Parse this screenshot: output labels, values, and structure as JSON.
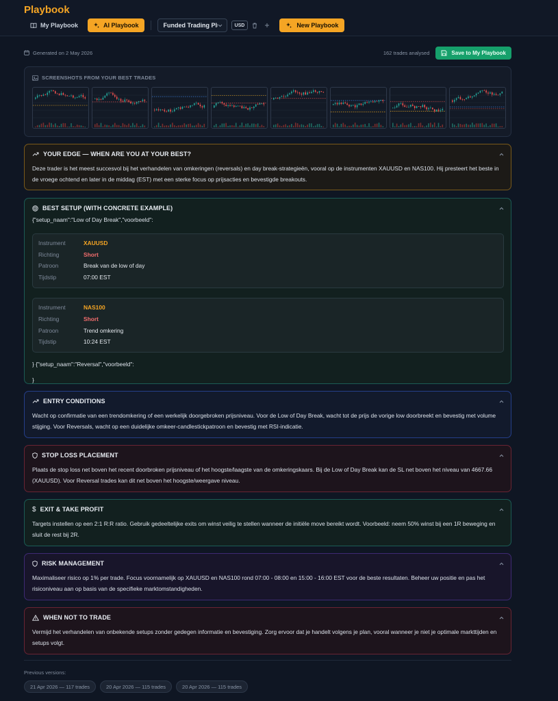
{
  "app": {
    "title": "Playbook"
  },
  "tabs": [
    {
      "label": "My Playbook",
      "icon": "book-icon"
    },
    {
      "label": "AI Playbook",
      "icon": "sparkle-icon"
    }
  ],
  "account": {
    "selected": "Funded Trading Plus",
    "currency": "USD"
  },
  "new_playbook_label": "New Playbook",
  "header": {
    "generated": "Generated on 2 May 2026",
    "trades_analysed": "162 trades analysed",
    "save_label": "Save to My Playbook"
  },
  "screenshots": {
    "title": "SCREENSHOTS FROM YOUR BEST TRADES",
    "count": 8
  },
  "sections": {
    "edge": {
      "title": "YOUR EDGE — WHEN ARE YOU AT YOUR BEST?",
      "body": "Deze trader is het meest succesvol bij het verhandelen van omkeringen (reversals) en day break-strategieën, vooral op de instrumenten XAUUSD en NAS100. Hij presteert het beste in de vroege ochtend en later in de middag (EST) met een sterke focus op prijsacties en bevestigde breakouts."
    },
    "setup": {
      "title": "BEST SETUP (WITH CONCRETE EXAMPLE)",
      "raw_start": "{\"setup_naam\":\"Low of Day Break\",\"voorbeeld\":",
      "raw_mid": "} {\"setup_naam\":\"Reversal\",\"voorbeeld\":",
      "raw_end": "}",
      "examples": [
        {
          "rows": [
            {
              "key": "Instrument",
              "value": "XAUUSD"
            },
            {
              "key": "Richting",
              "value": "Short"
            },
            {
              "key": "Patroon",
              "value": "Break van de low of day"
            },
            {
              "key": "Tijdstip",
              "value": "07:00 EST"
            }
          ]
        },
        {
          "rows": [
            {
              "key": "Instrument",
              "value": "NAS100"
            },
            {
              "key": "Richting",
              "value": "Short"
            },
            {
              "key": "Patroon",
              "value": "Trend omkering"
            },
            {
              "key": "Tijdstip",
              "value": "10:24 EST"
            }
          ]
        }
      ]
    },
    "entry": {
      "title": "ENTRY CONDITIONS",
      "body": "Wacht op confirmatie van een trendomkering of een werkelijk doorgebroken prijsniveau. Voor de Low of Day Break, wacht tot de prijs de vorige low doorbreekt en bevestig met volume stijging. Voor Reversals, wacht op een duidelijke omkeer-candlestickpatroon en bevestig met RSI-indicatie."
    },
    "stoploss": {
      "title": "STOP LOSS PLACEMENT",
      "body": "Plaats de stop loss net boven het recent doorbroken prijsniveau of het hoogste/laagste van de omkeringskaars. Bij de Low of Day Break kan de SL net boven het niveau van 4667.66 (XAUUSD). Voor Reversal trades kan dit net boven het hoogste/weergave niveau."
    },
    "exit": {
      "title": "EXIT & TAKE PROFIT",
      "body": "Targets instellen op een 2:1 R:R ratio. Gebruik gedeeltelijke exits om winst veilig te stellen wanneer de initiële move bereikt wordt. Voorbeeld: neem 50% winst bij een 1R beweging en sluit de rest bij 2R."
    },
    "risk": {
      "title": "RISK MANAGEMENT",
      "body": "Maximaliseer risico op 1% per trade. Focus voornamelijk op XAUUSD en NAS100 rond 07:00 - 08:00 en 15:00 - 16:00 EST voor de beste resultaten. Beheer uw positie en pas het risiconiveau aan op basis van de specifieke marktomstandigheden."
    },
    "notrade": {
      "title": "WHEN NOT TO TRADE",
      "body": "Vermijd het verhandelen van onbekende setups zonder gedegen informatie en bevestiging. Zorg ervoor dat je handelt volgens je plan, vooral wanneer je niet je optimale markttijden en setups volgt."
    }
  },
  "previous": {
    "label": "Previous versions:",
    "versions": [
      "21 Apr 2026 — 117 trades",
      "20 Apr 2026 — 115 trades",
      "20 Apr 2026 — 115 trades"
    ]
  },
  "colors": {
    "accent": "#f5a524",
    "save_green": "#16a06b",
    "short_red": "#f26d6d",
    "edge_border": "#7a5a1a",
    "setup_border": "#1b5c55",
    "entry_border": "#253f8a",
    "stoploss_border": "#6a2433",
    "risk_border": "#3f2a74"
  }
}
